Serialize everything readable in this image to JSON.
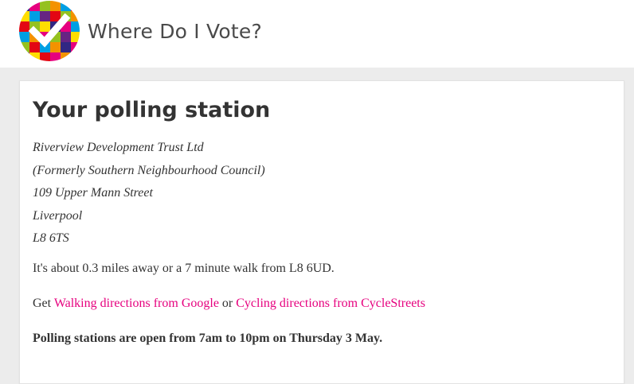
{
  "header": {
    "site_title": "Where Do I Vote?",
    "brand_colors": [
      "#e6007e",
      "#f39200",
      "#ffdd00",
      "#95c11f",
      "#009fe3",
      "#312783",
      "#e30613",
      "#662483"
    ]
  },
  "polling_station": {
    "heading": "Your polling station",
    "address_lines": [
      "Riverview Development Trust Ltd",
      "(Formerly Southern Neighbourhood Council)",
      "109 Upper Mann Street",
      "Liverpool",
      "L8 6TS"
    ],
    "distance_text": "It's about 0.3 miles away or a 7 minute walk from L8 6UD.",
    "directions": {
      "prefix": "Get ",
      "walking_link": "Walking directions from Google",
      "connector": " or ",
      "cycling_link": "Cycling directions from CycleStreets"
    },
    "opening_hours": "Polling stations are open from 7am to 10pm on Thursday 3 May."
  },
  "colors": {
    "link": "#e6007e",
    "page_background": "#ececec",
    "card_background": "#ffffff"
  }
}
